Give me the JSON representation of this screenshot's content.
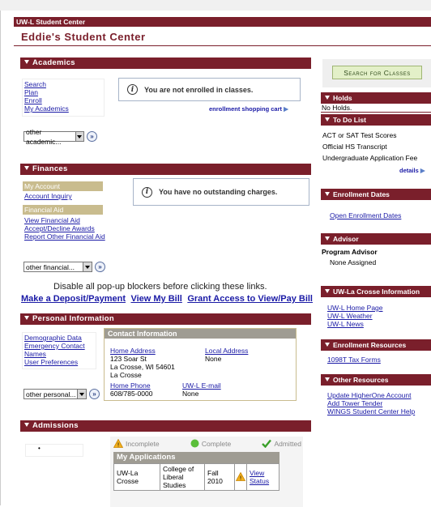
{
  "app_bar": "UW-L Student Center",
  "page_title": "Eddie's Student Center",
  "academics": {
    "header": "Academics",
    "links": [
      "Search",
      "Plan",
      "Enroll",
      "My Academics"
    ],
    "message": "You are not enrolled in classes.",
    "cart_link": "enrollment shopping cart",
    "select_value": "other academic..."
  },
  "finances": {
    "header": "Finances",
    "my_account_label": "My Account",
    "account_link": "Account Inquiry",
    "fin_aid_label": "Financial Aid",
    "fin_aid_links": [
      "View Financial Aid",
      "Accept/Decline Awards",
      "Report Other Financial Aid"
    ],
    "message": "You have no outstanding charges.",
    "select_value": "other financial..."
  },
  "popup_notice": "Disable all pop-up blockers before clicking these links.",
  "payment_links": [
    "Make a Deposit/Payment",
    "View My Bill",
    "Grant Access to View/Pay Bill"
  ],
  "personal": {
    "header": "Personal Information",
    "links": [
      "Demographic Data",
      "Emergency Contact",
      "Names",
      "User Preferences"
    ],
    "select_value": "other personal...",
    "contact": {
      "header": "Contact Information",
      "home_address_label": "Home Address",
      "home_address_lines": [
        "123 Soar St",
        "La Crosse, WI 54601",
        "La Crosse"
      ],
      "local_address_label": "Local Address",
      "local_address_value": "None",
      "home_phone_label": "Home Phone",
      "home_phone_value": "608/785-0000",
      "email_label": "UW-L E-mail",
      "email_value": "None"
    }
  },
  "admissions": {
    "header": "Admissions",
    "legend": [
      "Incomplete",
      "Complete",
      "Admitted"
    ],
    "apps_header": "My Applications",
    "row": {
      "campus": "UW-La Crosse",
      "college": "College of Liberal Studies",
      "term": "Fall 2010",
      "status_link": "View Status"
    }
  },
  "right": {
    "search_button": "Search for Classes",
    "holds": {
      "header": "Holds",
      "text": "No Holds."
    },
    "todo": {
      "header": "To Do List",
      "items": [
        "ACT or SAT Test Scores",
        "Official HS Transcript",
        "Undergraduate Application Fee"
      ],
      "details": "details"
    },
    "enrollment_dates": {
      "header": "Enrollment Dates",
      "link": "Open Enrollment Dates"
    },
    "advisor": {
      "header": "Advisor",
      "label": "Program Advisor",
      "value": "None Assigned"
    },
    "info": {
      "header": "UW-La Crosse Information",
      "links": [
        "UW-L Home Page",
        "UW-L Weather",
        "UW-L News"
      ]
    },
    "enroll_res": {
      "header": "Enrollment Resources",
      "link": "1098T Tax Forms"
    },
    "other_res": {
      "header": "Other Resources",
      "links": [
        "Update HigherOne Account",
        "Add Tower Tender",
        "WINGS Student Center Help"
      ]
    }
  },
  "colors": {
    "maroon": "#7a1f2b",
    "link": "#1a1aa6",
    "tan": "#c9bc8e",
    "green_button": "#e3f0c8"
  }
}
